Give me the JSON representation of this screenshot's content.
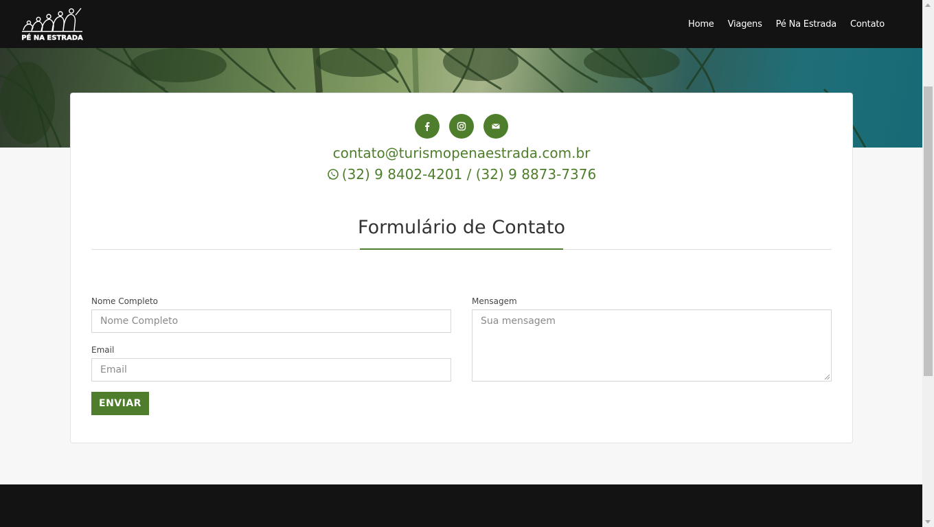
{
  "header": {
    "logo_text": "PÉ NA ESTRADA",
    "nav": [
      {
        "label": "Home"
      },
      {
        "label": "Viagens"
      },
      {
        "label": "Pé Na Estrada"
      },
      {
        "label": "Contato"
      }
    ]
  },
  "contact": {
    "social_icons": [
      "facebook-icon",
      "instagram-icon",
      "mail-icon"
    ],
    "email": "contato@turismopenaestrada.com.br",
    "phones": "(32) 9 8402-4201 / (32) 9 8873-7376",
    "accent_color": "#4e7d2b"
  },
  "form": {
    "title": "Formulário de Contato",
    "name_label": "Nome Completo",
    "name_placeholder": "Nome Completo",
    "email_label": "Email",
    "email_placeholder": "Email",
    "message_label": "Mensagem",
    "message_placeholder": "Sua mensagem",
    "submit_label": "ENVIAR"
  }
}
